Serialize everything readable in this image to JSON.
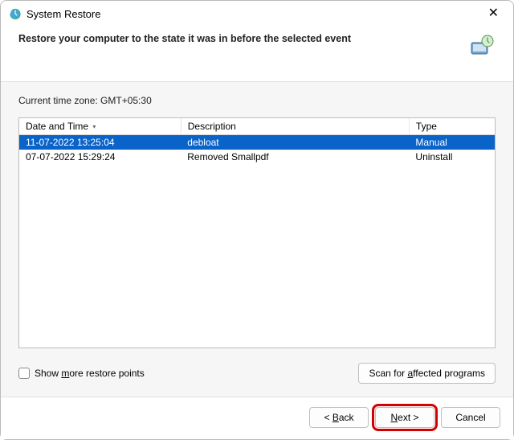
{
  "window": {
    "title": "System Restore"
  },
  "header": {
    "text": "Restore your computer to the state it was in before the selected event"
  },
  "timezone_label": "Current time zone: GMT+05:30",
  "table": {
    "columns": {
      "datetime": "Date and Time",
      "description": "Description",
      "type": "Type"
    },
    "selected_index": 0,
    "rows": [
      {
        "datetime": "11-07-2022 13:25:04",
        "description": "debloat",
        "type": "Manual"
      },
      {
        "datetime": "07-07-2022 15:29:24",
        "description": "Removed Smallpdf",
        "type": "Uninstall"
      }
    ]
  },
  "options": {
    "show_more_prefix": "Show ",
    "show_more_u": "m",
    "show_more_suffix": "ore restore points",
    "scan_prefix": "Scan for ",
    "scan_u": "a",
    "scan_suffix": "ffected programs"
  },
  "footer": {
    "back_prefix": "< ",
    "back_u": "B",
    "back_suffix": "ack",
    "next_u": "N",
    "next_suffix": "ext >",
    "cancel": "Cancel"
  }
}
